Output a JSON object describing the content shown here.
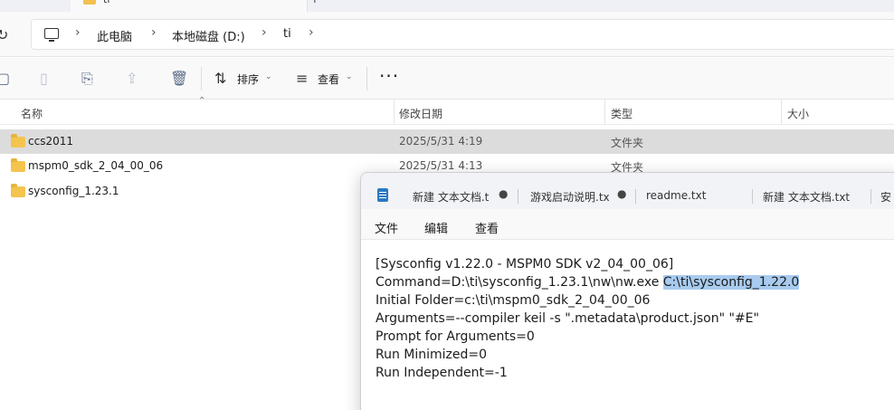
{
  "explorer": {
    "window_tab_title": "ti",
    "breadcrumb": [
      "此电脑",
      "本地磁盘 (D:)",
      "ti"
    ],
    "toolbar": {
      "sort_label": "排序",
      "view_label": "查看",
      "more_label": "···"
    },
    "columns": {
      "name": "名称",
      "date": "修改日期",
      "type": "类型",
      "size": "大小"
    },
    "rows": [
      {
        "name": "ccs2011",
        "date": "2025/5/31 4:19",
        "type": "文件夹",
        "selected": true
      },
      {
        "name": "mspm0_sdk_2_04_00_06",
        "date": "2025/5/31 4:13",
        "type": "文件夹",
        "selected": false
      },
      {
        "name": "sysconfig_1.23.1",
        "date": "",
        "type": "",
        "selected": false
      }
    ]
  },
  "notepad": {
    "tabs": [
      {
        "label": "新建 文本文档.t",
        "modified": true
      },
      {
        "label": "游戏启动说明.tx",
        "modified": true
      },
      {
        "label": "readme.txt",
        "modified": false
      },
      {
        "label": "新建 文本文档.txt",
        "modified": false
      },
      {
        "label": "安",
        "modified": false
      }
    ],
    "modified_marker": "●",
    "menus": [
      "文件",
      "编辑",
      "查看"
    ],
    "lines": [
      "[Sysconfig v1.22.0 - MSPM0 SDK v2_04_00_06]",
      "Command=D:\\ti\\sysconfig_1.23.1\\nw\\nw.exe ",
      "Initial Folder=c:\\ti\\mspm0_sdk_2_04_00_06",
      "Arguments=--compiler keil -s \".metadata\\product.json\" \"#E\"",
      "Prompt for Arguments=0",
      "Run Minimized=0",
      "Run Independent=-1"
    ],
    "selected_text": "C:\\ti\\sysconfig_1.22.0"
  },
  "colors": {
    "selection_highlight": "#a8cbef",
    "selected_row": "#dcdcdc",
    "folder": "#f4c44f",
    "notepad_icon": "#2b78c2"
  },
  "icons": [
    "refresh-icon",
    "computer-icon",
    "chevron-right-icon",
    "new-icon",
    "paste-icon",
    "rename-icon",
    "share-icon",
    "delete-icon",
    "sort-icon",
    "view-icon",
    "folder-icon",
    "notepad-icon"
  ]
}
